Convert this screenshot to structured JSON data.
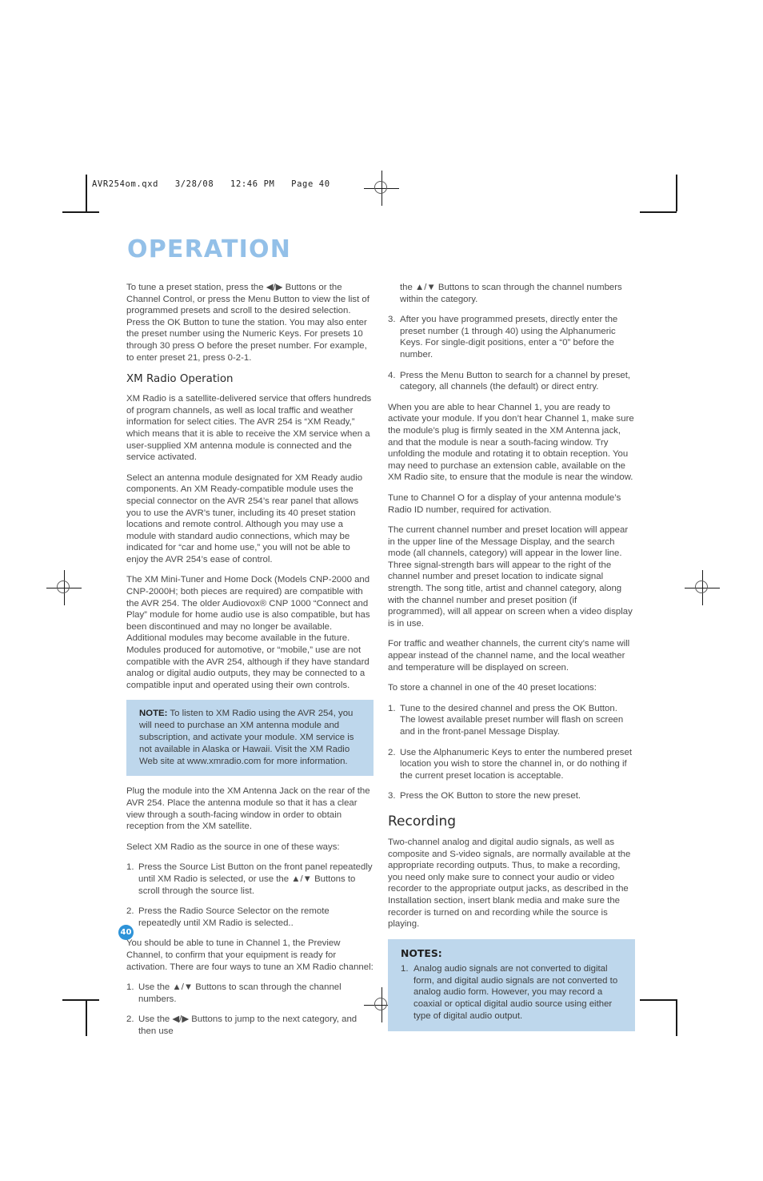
{
  "file_header": "AVR254om.qxd   3/28/08   12:46 PM   Page 40",
  "page_title": "OPERATION",
  "page_number": "40",
  "left_column": {
    "intro_paragraph": "To tune a preset station, press the ◀/▶ Buttons or the Channel Control, or press the Menu Button to view the list of programmed presets and scroll to the desired selection. Press the OK Button to tune the station. You may also enter the preset number using the Numeric Keys. For presets 10 through 30 press O before the preset number. For example, to enter preset 21, press 0-2-1.",
    "xm_heading": "XM Radio Operation",
    "xm_para_1": "XM Radio is a satellite-delivered service that offers hundreds of program channels, as well as local traffic and weather information for select cities. The AVR 254 is “XM Ready,” which means that it is able to receive the XM service when a user-supplied XM antenna module is connected and the service activated.",
    "xm_para_2": "Select an antenna module designated for XM Ready audio components. An XM Ready-compatible module uses the special connector on the AVR 254’s rear panel that allows you to use the AVR’s tuner, including its 40 preset station locations and remote control. Although you may use a module with standard audio connections, which may be indicated for “car and home use,” you will not be able to enjoy the AVR 254’s ease of control.",
    "xm_para_3": "The XM Mini-Tuner and Home Dock (Models CNP-2000 and CNP-2000H; both pieces are required) are compatible with the AVR 254. The older Audiovox® CNP 1000 “Connect and Play” module for home audio use is also compatible, but has been discontinued and may no longer be available. Additional modules may become available in the future. Modules produced for automotive, or “mobile,” use are not compatible with the AVR 254, although if they have standard analog or digital audio outputs, they may be connected to a compatible input and operated using their own controls.",
    "note_label": "NOTE:",
    "note_text": " To listen to XM Radio using the AVR 254, you will need to purchase an XM antenna module and subscription, and activate your module. XM service is not available in Alaska or Hawaii. Visit the XM Radio Web site at www.xmradio.com for more information.",
    "xm_para_4": "Plug the module into the XM Antenna Jack on the rear of the AVR 254. Place the antenna module so that it has a clear view through a south-facing window in order to obtain reception from the XM satellite.",
    "select_intro": "Select XM Radio as the source in one of these ways:",
    "select_list": [
      {
        "num": "1.",
        "text": "Press the Source List Button on the front panel repeatedly until XM Radio is selected, or use the ▲/▼ Buttons to scroll through the source list."
      },
      {
        "num": "2.",
        "text": "Press the Radio Source Selector on the remote repeatedly until XM Radio is selected.."
      }
    ],
    "tune_intro": "You should be able to tune in Channel 1, the Preview Channel, to confirm that your equipment is ready for activation. There are four ways to tune an XM Radio channel:",
    "tune_list": [
      {
        "num": "1.",
        "text": "Use the ▲/▼ Buttons to scan through the channel numbers."
      },
      {
        "num": "2.",
        "text": "Use the ◀/▶ Buttons to jump to the next category, and then use"
      }
    ]
  },
  "right_column": {
    "continued_text": "the ▲/▼ Buttons to scan through the channel numbers within the category.",
    "tune_list_cont": [
      {
        "num": "3.",
        "text": "After you have programmed presets, directly enter the preset number (1 through 40) using the Alphanumeric Keys. For single-digit positions, enter a “0” before the number."
      },
      {
        "num": "4.",
        "text": "Press the Menu Button to search for a channel by preset, category, all channels (the default) or direct entry."
      }
    ],
    "para_1": "When you are able to hear Channel 1, you are ready to activate your module. If you don’t hear Channel 1, make sure the module’s plug is firmly seated in the XM Antenna jack, and that the module is near a south-facing window. Try unfolding the module and rotating it to obtain reception. You may need to purchase an extension cable, available on the XM Radio site, to ensure that the module is near the window.",
    "para_2": "Tune to Channel O for a display of your antenna module’s Radio ID number, required for activation.",
    "para_3": "The current channel number and preset location will appear in the upper line of the Message Display, and the search mode (all channels, category) will appear in the lower line. Three signal-strength bars will appear to the right of the channel number and preset location to indicate signal strength. The song title, artist and channel category, along with the channel number and preset position (if programmed), will all appear on screen when a video display is in use.",
    "para_4": "For traffic and weather channels, the current city’s name will appear instead of the channel name, and the local weather and temperature will be displayed on screen.",
    "store_intro": "To store a channel in one of the 40 preset locations:",
    "store_list": [
      {
        "num": "1.",
        "text": "Tune to the desired channel and press the OK Button. The lowest available preset number will flash on screen and in the front-panel Message Display."
      },
      {
        "num": "2.",
        "text": "Use the Alphanumeric Keys to enter the numbered preset location you wish to store the channel in, or do nothing if the current preset location is acceptable."
      },
      {
        "num": "3.",
        "text": "Press the OK Button to store the new preset."
      }
    ],
    "recording_heading": "Recording",
    "recording_para": "Two-channel analog and digital audio signals, as well as composite and S-video signals, are normally available at the appropriate recording outputs. Thus, to make a recording, you need only make sure to connect your audio or video recorder to the appropriate output jacks, as described in the Installation section, insert blank media and make sure the recorder is turned on and recording while the source is playing.",
    "notes_title": "NOTES:",
    "notes_list": [
      {
        "num": "1.",
        "text": "Analog audio signals are not converted to digital form, and digital audio signals are not converted to analog audio form. However, you may record a coaxial or optical digital audio source using either type of digital audio output."
      }
    ]
  },
  "colors": {
    "title_blue": "#93c0e8",
    "note_bg": "#bed7ec",
    "badge_blue": "#2e93d8"
  }
}
